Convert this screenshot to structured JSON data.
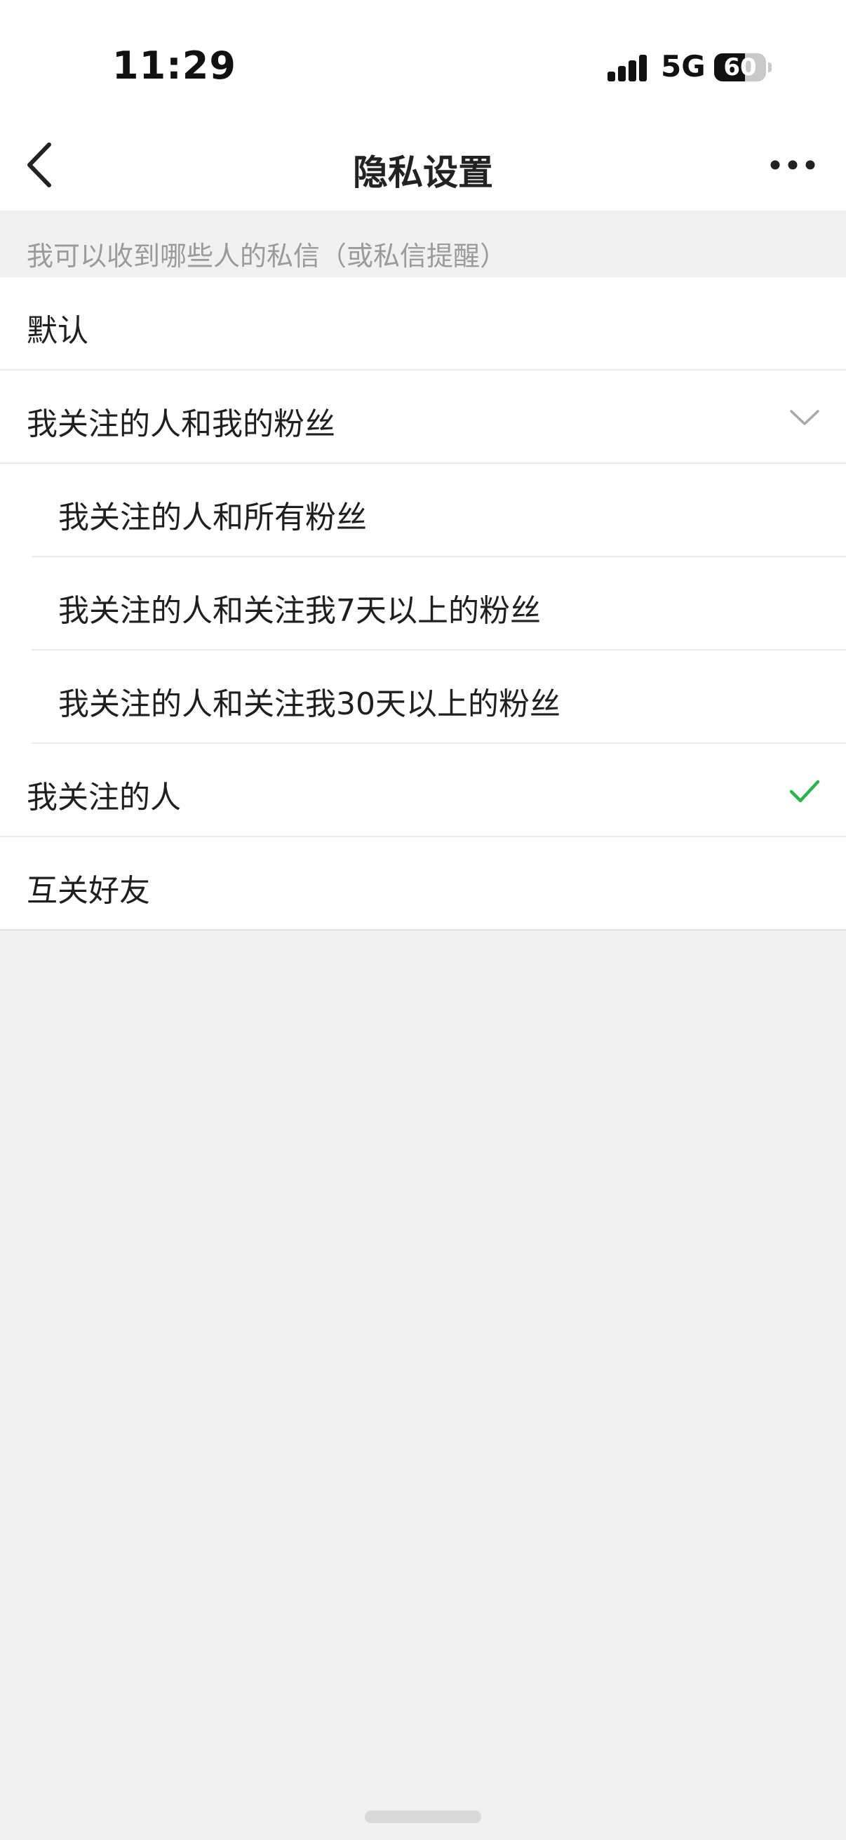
{
  "status_bar": {
    "time": "11:29",
    "network": "5G",
    "battery": "60",
    "battery_level": 0.6
  },
  "nav": {
    "title": "隐私设置"
  },
  "section": {
    "header": "我可以收到哪些人的私信（或私信提醒）"
  },
  "options": [
    {
      "label": "默认",
      "level": "top",
      "state": "none"
    },
    {
      "label": "我关注的人和我的粉丝",
      "level": "top",
      "state": "expanded"
    },
    {
      "label": "我关注的人和所有粉丝",
      "level": "sub",
      "state": "none"
    },
    {
      "label": "我关注的人和关注我7天以上的粉丝",
      "level": "sub",
      "state": "none"
    },
    {
      "label": "我关注的人和关注我30天以上的粉丝",
      "level": "sub",
      "state": "none"
    },
    {
      "label": "我关注的人",
      "level": "top",
      "state": "selected"
    },
    {
      "label": "互关好友",
      "level": "top",
      "state": "none"
    }
  ],
  "icons": {
    "back": "chevron-left-icon",
    "more": "more-dots-icon",
    "expand": "chevron-down-icon",
    "selected": "checkmark-icon"
  },
  "colors": {
    "accent_check": "#2bb34a",
    "header_text": "#9b9b9b",
    "background": "#f1f1f1"
  }
}
